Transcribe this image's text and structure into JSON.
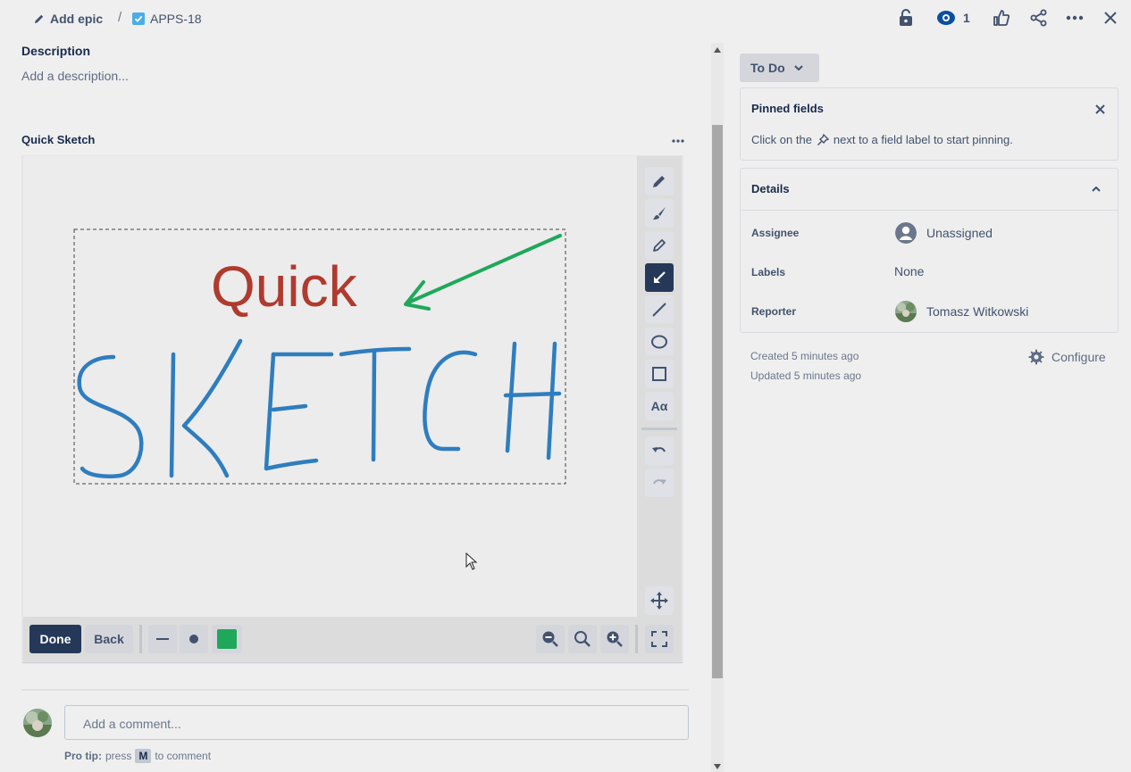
{
  "header": {
    "add_epic": "Add epic",
    "separator": "/",
    "issue_key": "APPS-18",
    "watch_count": "1"
  },
  "description": {
    "title": "Description",
    "placeholder": "Add a description..."
  },
  "sketch": {
    "title": "Quick Sketch",
    "canvas_text_red": "Quick",
    "canvas_text_blue": "SKETCH",
    "tools": [
      "pencil-icon",
      "brush-icon",
      "highlighter-icon",
      "arrow-icon",
      "line-icon",
      "ellipse-icon",
      "rectangle-icon",
      "text-icon",
      "undo-icon",
      "redo-icon",
      "move-icon"
    ],
    "text_tool_label": "Aα",
    "done_label": "Done",
    "back_label": "Back",
    "color": "#1fa85a",
    "red_color": "#b03a2e",
    "blue_color": "#2e7dbf"
  },
  "comment": {
    "placeholder": "Add a comment...",
    "tip_prefix": "Pro tip:",
    "tip_press": "press",
    "tip_key": "M",
    "tip_suffix": "to comment"
  },
  "sidebar": {
    "status": "To Do",
    "pinned": {
      "title": "Pinned fields",
      "text_before": "Click on the",
      "text_after": "next to a field label to start pinning."
    },
    "details": {
      "title": "Details",
      "rows": [
        {
          "label": "Assignee",
          "value": "Unassigned"
        },
        {
          "label": "Labels",
          "value": "None"
        },
        {
          "label": "Reporter",
          "value": "Tomasz Witkowski"
        }
      ]
    },
    "created": "Created 5 minutes ago",
    "updated": "Updated 5 minutes ago",
    "configure": "Configure"
  }
}
